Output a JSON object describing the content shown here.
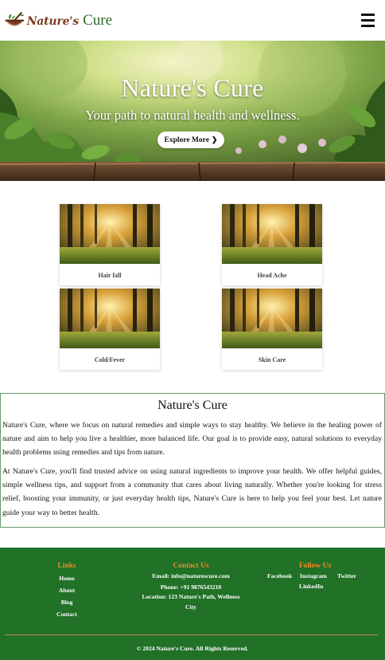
{
  "header": {
    "brand_part1": "Nature's",
    "brand_part2": "Cure",
    "menu_icon": "hamburger-menu-icon",
    "brand_color": "#7a3b1d",
    "brand_accent": "#2a6a2a"
  },
  "hero": {
    "title": "Nature's Cure",
    "subtitle": "Your path to natural health and wellness.",
    "button_label": "Explore More",
    "button_icon": "chevron-right-icon"
  },
  "cards": [
    {
      "label": "Hair fall"
    },
    {
      "label": "Head Ache"
    },
    {
      "label": "Cold/Fever"
    },
    {
      "label": "Skin Care"
    }
  ],
  "about": {
    "title": "Nature's Cure",
    "paragraph1": "Nature's Cure, where we focus on natural remedies and simple ways to stay healthy. We believe in the healing power of nature and aim to help you live a healthier, more balanced life. Our goal is to provide easy, natural solutions to everyday health problems using remedies and tips from nature.",
    "paragraph2": "At Nature's Cure, you'll find trusted advice on using natural ingredients to improve your health. We offer helpful guides, simple wellness tips, and support from a community that cares about living naturally. Whether you're looking for stress relief, boosting your immunity, or just everyday health tips, Nature's Cure is here to help you feel your best. Let nature guide your way to better health."
  },
  "footer": {
    "links": {
      "heading": "Links",
      "items": [
        "Home",
        "About",
        "Blog",
        "Contact"
      ]
    },
    "contact": {
      "heading": "Contact Us",
      "email": "Email: info@naturescure.com",
      "phone": "Phone: +91 9876543210",
      "location_line1": "Location: 123 Nature's Path, Wellness",
      "location_line2": "City"
    },
    "follow": {
      "heading": "Follow Us",
      "items": [
        "Facebook",
        "Instagram",
        "Twitter",
        "LinkedIn"
      ]
    },
    "copyright": "© 2024 Nature's Cure. All Rights Reserved.",
    "bg_color": "#217127",
    "heading_color": "#f08a2a"
  }
}
